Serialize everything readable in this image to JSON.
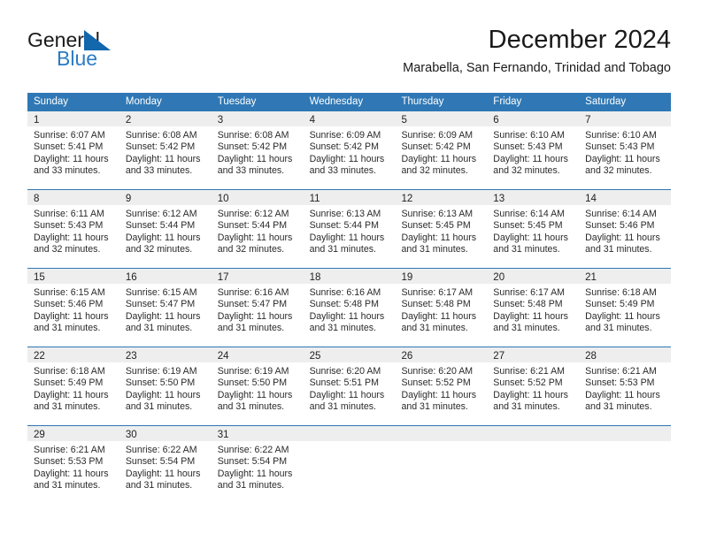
{
  "brand": {
    "name_part1": "General",
    "name_part2": "Blue",
    "mark": "triangle-logo-icon",
    "blue": "#2b7cc4"
  },
  "header": {
    "title": "December 2024",
    "subtitle": "Marabella, San Fernando, Trinidad and Tobago"
  },
  "colors": {
    "header_blue": "#2f78b5",
    "day_band_gray": "#eeeeee",
    "text": "#222222"
  },
  "weekdays": [
    "Sunday",
    "Monday",
    "Tuesday",
    "Wednesday",
    "Thursday",
    "Friday",
    "Saturday"
  ],
  "weeks": [
    [
      {
        "day": "1",
        "sunrise": "Sunrise: 6:07 AM",
        "sunset": "Sunset: 5:41 PM",
        "daylight_1": "Daylight: 11 hours",
        "daylight_2": "and 33 minutes."
      },
      {
        "day": "2",
        "sunrise": "Sunrise: 6:08 AM",
        "sunset": "Sunset: 5:42 PM",
        "daylight_1": "Daylight: 11 hours",
        "daylight_2": "and 33 minutes."
      },
      {
        "day": "3",
        "sunrise": "Sunrise: 6:08 AM",
        "sunset": "Sunset: 5:42 PM",
        "daylight_1": "Daylight: 11 hours",
        "daylight_2": "and 33 minutes."
      },
      {
        "day": "4",
        "sunrise": "Sunrise: 6:09 AM",
        "sunset": "Sunset: 5:42 PM",
        "daylight_1": "Daylight: 11 hours",
        "daylight_2": "and 33 minutes."
      },
      {
        "day": "5",
        "sunrise": "Sunrise: 6:09 AM",
        "sunset": "Sunset: 5:42 PM",
        "daylight_1": "Daylight: 11 hours",
        "daylight_2": "and 32 minutes."
      },
      {
        "day": "6",
        "sunrise": "Sunrise: 6:10 AM",
        "sunset": "Sunset: 5:43 PM",
        "daylight_1": "Daylight: 11 hours",
        "daylight_2": "and 32 minutes."
      },
      {
        "day": "7",
        "sunrise": "Sunrise: 6:10 AM",
        "sunset": "Sunset: 5:43 PM",
        "daylight_1": "Daylight: 11 hours",
        "daylight_2": "and 32 minutes."
      }
    ],
    [
      {
        "day": "8",
        "sunrise": "Sunrise: 6:11 AM",
        "sunset": "Sunset: 5:43 PM",
        "daylight_1": "Daylight: 11 hours",
        "daylight_2": "and 32 minutes."
      },
      {
        "day": "9",
        "sunrise": "Sunrise: 6:12 AM",
        "sunset": "Sunset: 5:44 PM",
        "daylight_1": "Daylight: 11 hours",
        "daylight_2": "and 32 minutes."
      },
      {
        "day": "10",
        "sunrise": "Sunrise: 6:12 AM",
        "sunset": "Sunset: 5:44 PM",
        "daylight_1": "Daylight: 11 hours",
        "daylight_2": "and 32 minutes."
      },
      {
        "day": "11",
        "sunrise": "Sunrise: 6:13 AM",
        "sunset": "Sunset: 5:44 PM",
        "daylight_1": "Daylight: 11 hours",
        "daylight_2": "and 31 minutes."
      },
      {
        "day": "12",
        "sunrise": "Sunrise: 6:13 AM",
        "sunset": "Sunset: 5:45 PM",
        "daylight_1": "Daylight: 11 hours",
        "daylight_2": "and 31 minutes."
      },
      {
        "day": "13",
        "sunrise": "Sunrise: 6:14 AM",
        "sunset": "Sunset: 5:45 PM",
        "daylight_1": "Daylight: 11 hours",
        "daylight_2": "and 31 minutes."
      },
      {
        "day": "14",
        "sunrise": "Sunrise: 6:14 AM",
        "sunset": "Sunset: 5:46 PM",
        "daylight_1": "Daylight: 11 hours",
        "daylight_2": "and 31 minutes."
      }
    ],
    [
      {
        "day": "15",
        "sunrise": "Sunrise: 6:15 AM",
        "sunset": "Sunset: 5:46 PM",
        "daylight_1": "Daylight: 11 hours",
        "daylight_2": "and 31 minutes."
      },
      {
        "day": "16",
        "sunrise": "Sunrise: 6:15 AM",
        "sunset": "Sunset: 5:47 PM",
        "daylight_1": "Daylight: 11 hours",
        "daylight_2": "and 31 minutes."
      },
      {
        "day": "17",
        "sunrise": "Sunrise: 6:16 AM",
        "sunset": "Sunset: 5:47 PM",
        "daylight_1": "Daylight: 11 hours",
        "daylight_2": "and 31 minutes."
      },
      {
        "day": "18",
        "sunrise": "Sunrise: 6:16 AM",
        "sunset": "Sunset: 5:48 PM",
        "daylight_1": "Daylight: 11 hours",
        "daylight_2": "and 31 minutes."
      },
      {
        "day": "19",
        "sunrise": "Sunrise: 6:17 AM",
        "sunset": "Sunset: 5:48 PM",
        "daylight_1": "Daylight: 11 hours",
        "daylight_2": "and 31 minutes."
      },
      {
        "day": "20",
        "sunrise": "Sunrise: 6:17 AM",
        "sunset": "Sunset: 5:48 PM",
        "daylight_1": "Daylight: 11 hours",
        "daylight_2": "and 31 minutes."
      },
      {
        "day": "21",
        "sunrise": "Sunrise: 6:18 AM",
        "sunset": "Sunset: 5:49 PM",
        "daylight_1": "Daylight: 11 hours",
        "daylight_2": "and 31 minutes."
      }
    ],
    [
      {
        "day": "22",
        "sunrise": "Sunrise: 6:18 AM",
        "sunset": "Sunset: 5:49 PM",
        "daylight_1": "Daylight: 11 hours",
        "daylight_2": "and 31 minutes."
      },
      {
        "day": "23",
        "sunrise": "Sunrise: 6:19 AM",
        "sunset": "Sunset: 5:50 PM",
        "daylight_1": "Daylight: 11 hours",
        "daylight_2": "and 31 minutes."
      },
      {
        "day": "24",
        "sunrise": "Sunrise: 6:19 AM",
        "sunset": "Sunset: 5:50 PM",
        "daylight_1": "Daylight: 11 hours",
        "daylight_2": "and 31 minutes."
      },
      {
        "day": "25",
        "sunrise": "Sunrise: 6:20 AM",
        "sunset": "Sunset: 5:51 PM",
        "daylight_1": "Daylight: 11 hours",
        "daylight_2": "and 31 minutes."
      },
      {
        "day": "26",
        "sunrise": "Sunrise: 6:20 AM",
        "sunset": "Sunset: 5:52 PM",
        "daylight_1": "Daylight: 11 hours",
        "daylight_2": "and 31 minutes."
      },
      {
        "day": "27",
        "sunrise": "Sunrise: 6:21 AM",
        "sunset": "Sunset: 5:52 PM",
        "daylight_1": "Daylight: 11 hours",
        "daylight_2": "and 31 minutes."
      },
      {
        "day": "28",
        "sunrise": "Sunrise: 6:21 AM",
        "sunset": "Sunset: 5:53 PM",
        "daylight_1": "Daylight: 11 hours",
        "daylight_2": "and 31 minutes."
      }
    ],
    [
      {
        "day": "29",
        "sunrise": "Sunrise: 6:21 AM",
        "sunset": "Sunset: 5:53 PM",
        "daylight_1": "Daylight: 11 hours",
        "daylight_2": "and 31 minutes."
      },
      {
        "day": "30",
        "sunrise": "Sunrise: 6:22 AM",
        "sunset": "Sunset: 5:54 PM",
        "daylight_1": "Daylight: 11 hours",
        "daylight_2": "and 31 minutes."
      },
      {
        "day": "31",
        "sunrise": "Sunrise: 6:22 AM",
        "sunset": "Sunset: 5:54 PM",
        "daylight_1": "Daylight: 11 hours",
        "daylight_2": "and 31 minutes."
      },
      {
        "day": "",
        "sunrise": "",
        "sunset": "",
        "daylight_1": "",
        "daylight_2": ""
      },
      {
        "day": "",
        "sunrise": "",
        "sunset": "",
        "daylight_1": "",
        "daylight_2": ""
      },
      {
        "day": "",
        "sunrise": "",
        "sunset": "",
        "daylight_1": "",
        "daylight_2": ""
      },
      {
        "day": "",
        "sunrise": "",
        "sunset": "",
        "daylight_1": "",
        "daylight_2": ""
      }
    ]
  ]
}
